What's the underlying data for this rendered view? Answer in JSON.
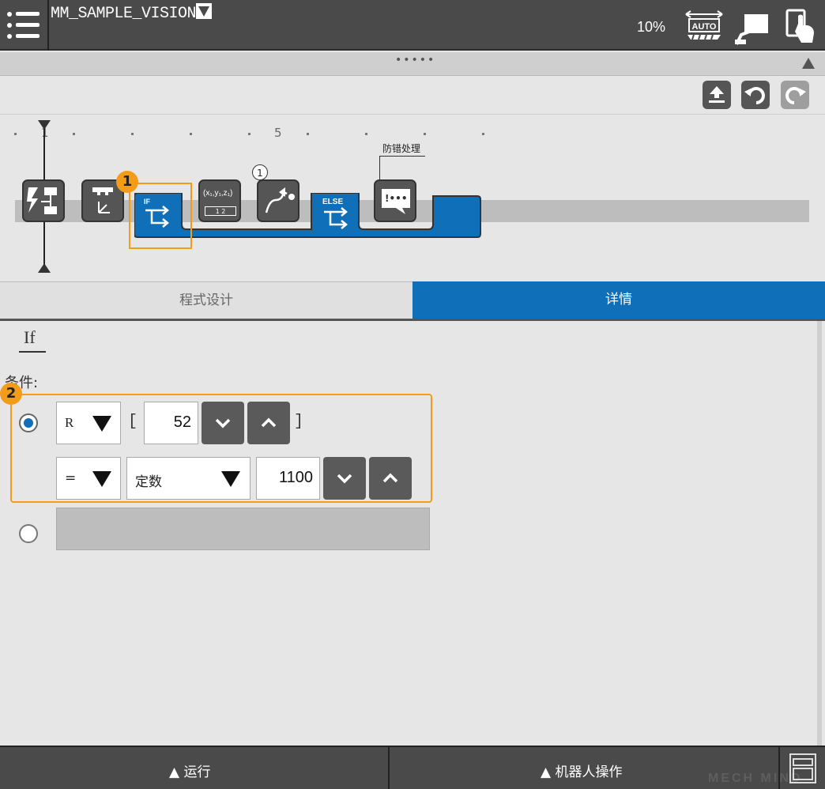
{
  "header": {
    "program_name": "MM_SAMPLE_VISION",
    "speed": "10%",
    "mode_icon_label": "AUTO"
  },
  "collapse": {
    "handle": "•••••"
  },
  "timeline": {
    "ruler_label": "1",
    "ruler_label_5": "5",
    "nodes": [
      {
        "name": "init-node",
        "icon": "flow-icon"
      },
      {
        "name": "coord-node",
        "icon": "coordinate-icon"
      },
      {
        "name": "if-node",
        "label": "IF"
      },
      {
        "name": "assign-node",
        "label": "(x₁,y₁,z₁)"
      },
      {
        "name": "move-node",
        "icon": "path-icon",
        "badge": "1"
      },
      {
        "name": "else-node",
        "label": "ELSE"
      },
      {
        "name": "error-handle-node",
        "label": "!•••",
        "caption": "防错处理"
      }
    ],
    "callout1": "1",
    "assign_sub": "1  2"
  },
  "tabs": {
    "program": "程式设计",
    "detail": "详情"
  },
  "detail": {
    "section_title": "If",
    "condition_label": "条件:",
    "callout2": "2",
    "row1": {
      "register": "R",
      "bracket_open": "[",
      "index": "52",
      "bracket_close": "]"
    },
    "row2": {
      "operator": "=",
      "type": "定数",
      "value": "1100"
    }
  },
  "footer": {
    "run": "▲ 运行",
    "robot": "▲ 机器人操作",
    "watermark": "MECH MIND"
  },
  "colors": {
    "accent": "#0f6fb8",
    "callout": "#f39c1a",
    "dark": "#4a4a4a"
  }
}
